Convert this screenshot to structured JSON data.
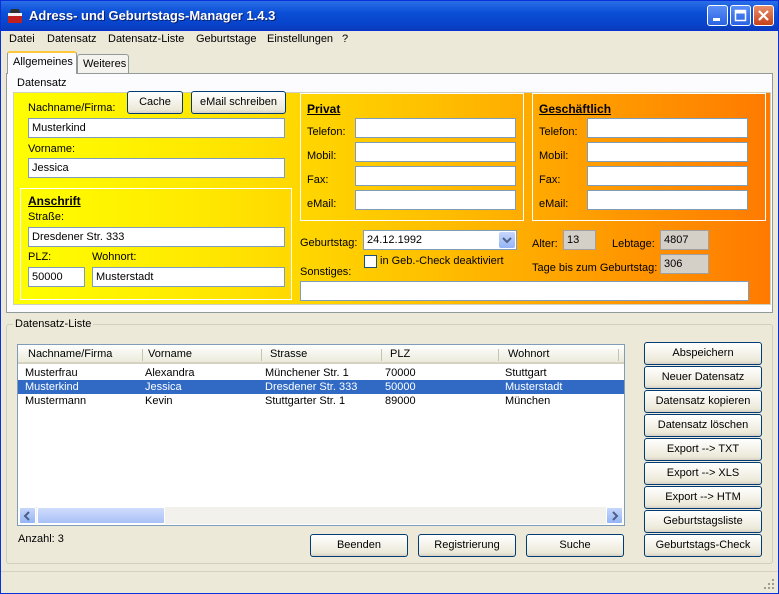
{
  "window": {
    "title": "Adress- und Geburtstags-Manager 1.4.3"
  },
  "menu": [
    "Datei",
    "Datensatz",
    "Datensatz-Liste",
    "Geburtstage",
    "Einstellungen",
    "?"
  ],
  "tabs": [
    "Allgemeines",
    "Weiteres"
  ],
  "datensatz": {
    "group_label": "Datensatz",
    "name_label": "Nachname/Firma:",
    "name_value": "Musterkind",
    "vorname_label": "Vorname:",
    "vorname_value": "Jessica",
    "cache_button": "Cache",
    "email_button": "eMail schreiben",
    "anschrift": {
      "title": "Anschrift",
      "strasse_label": "Straße:",
      "strasse_value": "Dresdener Str. 333",
      "plz_label": "PLZ:",
      "plz_value": "50000",
      "wohnort_label": "Wohnort:",
      "wohnort_value": "Musterstadt"
    },
    "privat": {
      "title": "Privat",
      "telefon": "Telefon:",
      "mobil": "Mobil:",
      "fax": "Fax:",
      "email": "eMail:"
    },
    "geschaeftlich": {
      "title": "Geschäftlich",
      "telefon": "Telefon:",
      "mobil": "Mobil:",
      "fax": "Fax:",
      "email": "eMail:"
    },
    "geburtstag_label": "Geburtstag:",
    "geburtstag_value": "24.12.1992",
    "geb_check_label": "in Geb.-Check deaktiviert",
    "sonstiges_label": "Sonstiges:",
    "alter_label": "Alter:",
    "alter_value": "13",
    "lebtage_label": "Lebtage:",
    "lebtage_value": "4807",
    "tage_label": "Tage bis zum Geburtstag:",
    "tage_value": "306"
  },
  "liste": {
    "group_label": "Datensatz-Liste",
    "columns": [
      "Nachname/Firma",
      "Vorname",
      "Strasse",
      "PLZ",
      "Wohnort"
    ],
    "rows": [
      [
        "Musterfrau",
        "Alexandra",
        "Münchener Str. 1",
        "70000",
        "Stuttgart"
      ],
      [
        "Musterkind",
        "Jessica",
        "Dresdener Str. 333",
        "50000",
        "Musterstadt"
      ],
      [
        "Mustermann",
        "Kevin",
        "Stuttgarter Str. 1",
        "89000",
        "München"
      ]
    ],
    "count_label": "Anzahl: 3"
  },
  "side_buttons": [
    "Abspeichern",
    "Neuer Datensatz",
    "Datensatz kopieren",
    "Datensatz löschen",
    "Export --> TXT",
    "Export --> XLS",
    "Export --> HTM",
    "Geburtstagsliste",
    "Geburtstags-Check"
  ],
  "bottom_buttons": [
    "Beenden",
    "Registrierung",
    "Suche"
  ]
}
